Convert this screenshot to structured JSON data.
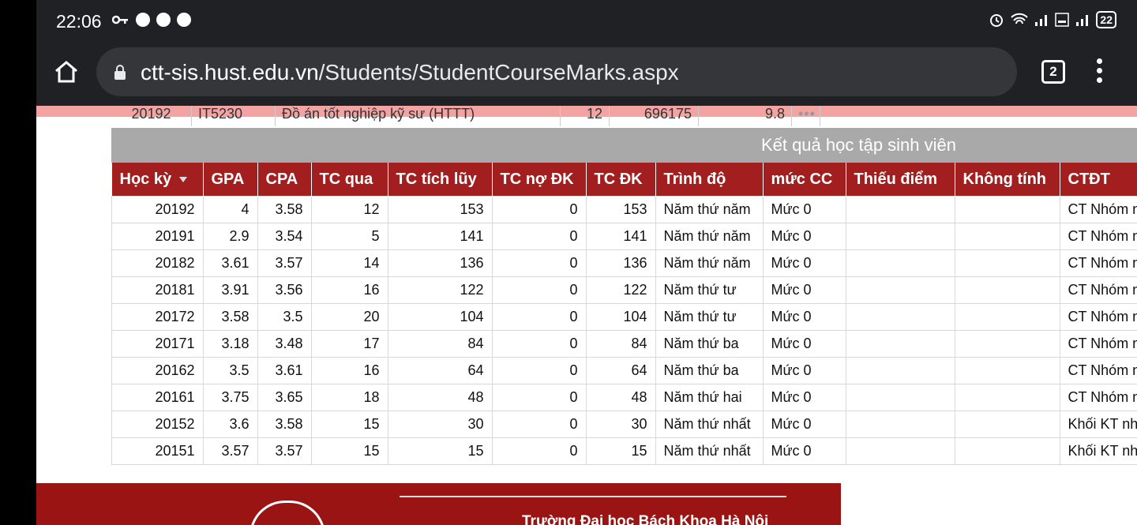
{
  "status_bar": {
    "time": "22:06",
    "battery": "22"
  },
  "browser": {
    "url_host": "ctt-sis.hust.edu.vn",
    "url_path": "/Students/StudentCourseMarks.aspx",
    "tab_count": "2"
  },
  "previous_row": {
    "term": "20192",
    "code": "IT5230",
    "name": "Đồ án tốt nghiệp kỹ sư (HTTT)",
    "credits": "12",
    "class": "696175",
    "score": "9.8",
    "more": "•••"
  },
  "results": {
    "title": "Kết quả học tập sinh viên",
    "columns": [
      "Học kỳ",
      "GPA",
      "CPA",
      "TC qua",
      "TC tích lũy",
      "TC nợ ĐK",
      "TC ĐK",
      "Trình độ",
      "mức CC",
      "Thiếu điểm",
      "Không tính",
      "CTĐT"
    ],
    "rows": [
      [
        "20192",
        "4",
        "3.58",
        "12",
        "153",
        "0",
        "153",
        "Năm thứ năm",
        "Mức 0",
        "",
        "",
        "CT Nhóm ng"
      ],
      [
        "20191",
        "2.9",
        "3.54",
        "5",
        "141",
        "0",
        "141",
        "Năm thứ năm",
        "Mức 0",
        "",
        "",
        "CT Nhóm ng"
      ],
      [
        "20182",
        "3.61",
        "3.57",
        "14",
        "136",
        "0",
        "136",
        "Năm thứ năm",
        "Mức 0",
        "",
        "",
        "CT Nhóm ng"
      ],
      [
        "20181",
        "3.91",
        "3.56",
        "16",
        "122",
        "0",
        "122",
        "Năm thứ tư",
        "Mức 0",
        "",
        "",
        "CT Nhóm ng"
      ],
      [
        "20172",
        "3.58",
        "3.5",
        "20",
        "104",
        "0",
        "104",
        "Năm thứ tư",
        "Mức 0",
        "",
        "",
        "CT Nhóm ng"
      ],
      [
        "20171",
        "3.18",
        "3.48",
        "17",
        "84",
        "0",
        "84",
        "Năm thứ ba",
        "Mức 0",
        "",
        "",
        "CT Nhóm ng"
      ],
      [
        "20162",
        "3.5",
        "3.61",
        "16",
        "64",
        "0",
        "64",
        "Năm thứ ba",
        "Mức 0",
        "",
        "",
        "CT Nhóm ng"
      ],
      [
        "20161",
        "3.75",
        "3.65",
        "18",
        "48",
        "0",
        "48",
        "Năm thứ hai",
        "Mức 0",
        "",
        "",
        "CT Nhóm ng"
      ],
      [
        "20152",
        "3.6",
        "3.58",
        "15",
        "30",
        "0",
        "30",
        "Năm thứ nhất",
        "Mức 0",
        "",
        "",
        "Khối KT nhó"
      ],
      [
        "20151",
        "3.57",
        "3.57",
        "15",
        "15",
        "0",
        "15",
        "Năm thứ nhất",
        "Mức 0",
        "",
        "",
        "Khối KT nhó"
      ]
    ]
  },
  "footer": {
    "university": "Trường Đại học Bách Khoa Hà Nội"
  }
}
